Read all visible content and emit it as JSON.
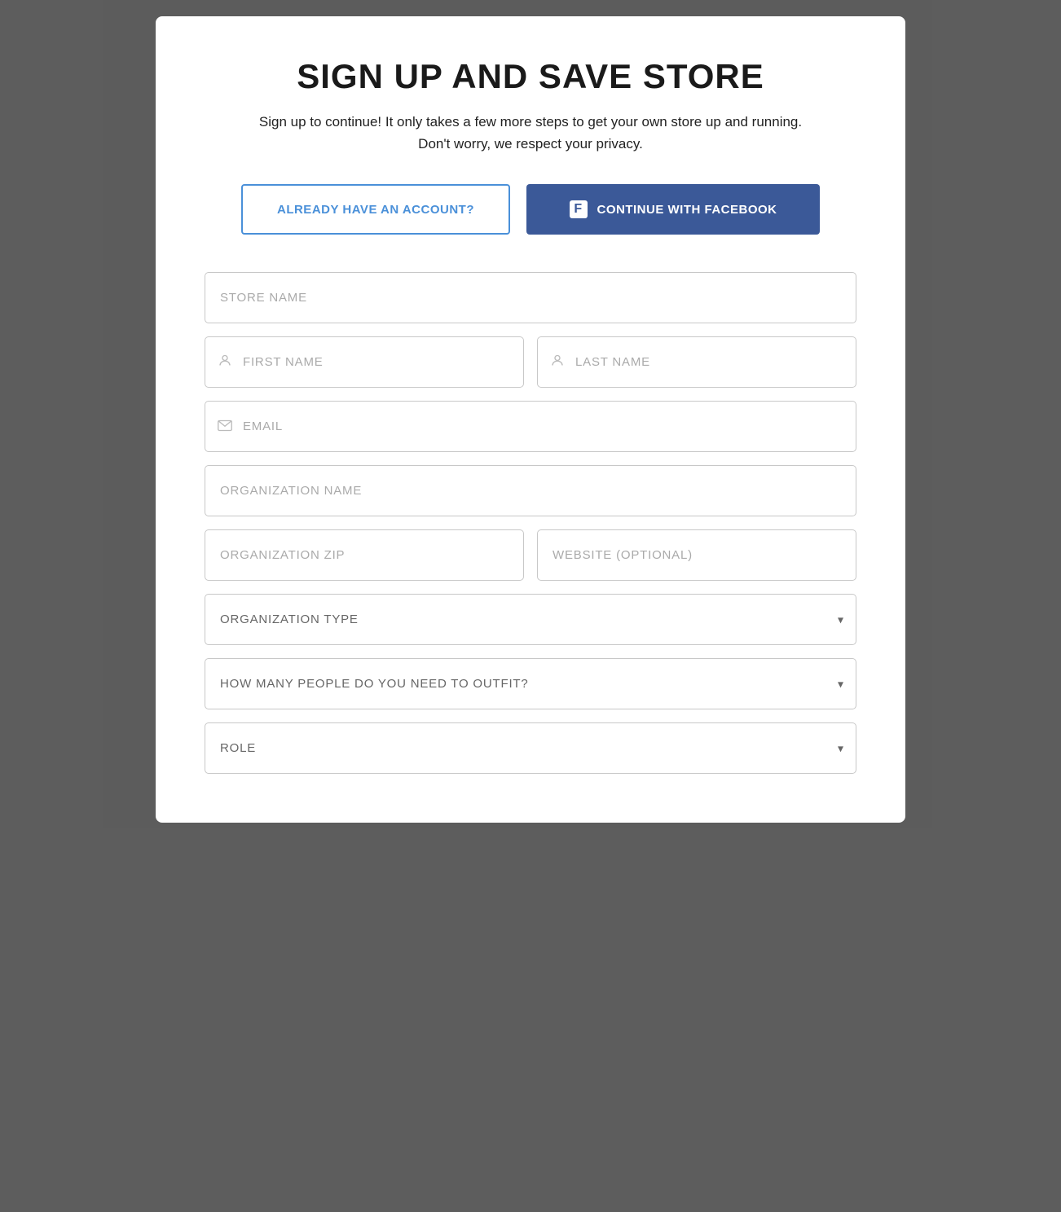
{
  "modal": {
    "title": "SIGN UP AND SAVE STORE",
    "subtitle_line1": "Sign up to continue! It only takes a few more steps to get your own store up and running.",
    "subtitle_line2": "Don't worry, we respect your privacy."
  },
  "buttons": {
    "account_label": "ALREADY HAVE AN ACCOUNT?",
    "facebook_label": "CONTINUE WITH FACEBOOK"
  },
  "form": {
    "store_name_placeholder": "STORE NAME",
    "first_name_placeholder": "FIRST NAME",
    "last_name_placeholder": "LAST NAME",
    "email_placeholder": "EMAIL",
    "org_name_placeholder": "ORGANIZATION NAME",
    "org_zip_placeholder": "ORGANIZATION ZIP",
    "website_placeholder": "WEBSITE (OPTIONAL)",
    "org_type_placeholder": "ORGANIZATION TYPE",
    "outfit_count_placeholder": "HOW MANY PEOPLE DO YOU NEED TO OUTFIT?",
    "role_placeholder": "ROLE"
  },
  "icons": {
    "person": "👤",
    "email": "✉",
    "chevron": "▾",
    "facebook_f": "f"
  },
  "colors": {
    "facebook_blue": "#3b5998",
    "link_blue": "#4a90d9",
    "border": "#c8c8c8",
    "text_dark": "#1a1a1a",
    "text_muted": "#aaa"
  }
}
